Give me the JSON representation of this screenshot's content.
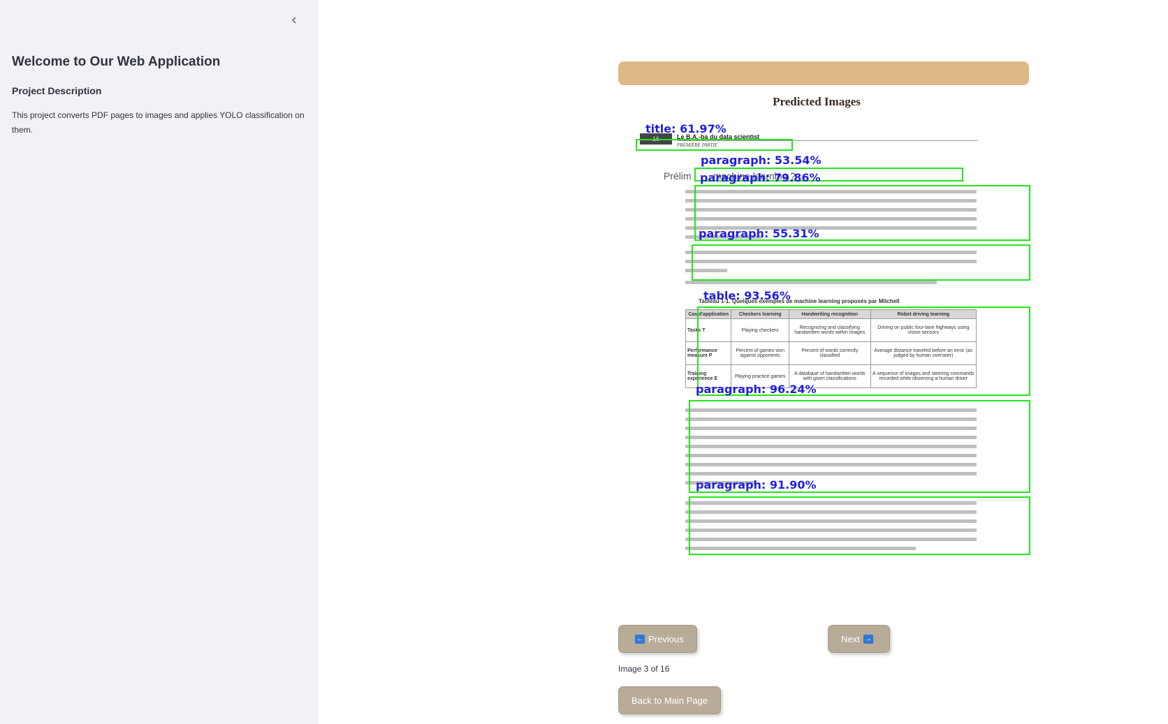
{
  "sidebar": {
    "title": "Welcome to Our Web Application",
    "section_heading": "Project Description",
    "description": "This project converts PDF pages to images and applies YOLO classification on them."
  },
  "main": {
    "heading": "Predicted Images",
    "banner_color": "#deb887",
    "predicted_image": {
      "page_number": "16",
      "page_header": "Le B.A.-ba du data scientist",
      "page_subheader": "PREMIÈRE PARTIE",
      "section_title": "Prélim        machine learning ?",
      "table_caption": "Tableau 1-1. Quelques exemples de machine learning proposés par Mitchell",
      "table": {
        "headers": [
          "Cas d'application",
          "Checkers learning",
          "Handwriting recognition",
          "Robot driving learning"
        ],
        "rows": [
          [
            "Tasks T",
            "Playing checkers",
            "Recognizing and classifying handwritten words within images",
            "Driving on public four-lane highways using vision sensors"
          ],
          [
            "Performance measure P",
            "Percent of games won against opponents",
            "Percent of words correctly classified",
            "Average distance traveled before an error (as judged by human overseer)"
          ],
          [
            "Training experience E",
            "Playing practice games",
            "A database of handwritten words with given classifications",
            "A sequence of images and steering commands recorded while observing a human driver"
          ]
        ]
      },
      "detections": [
        {
          "label": "title: 61.97%",
          "class": "title",
          "confidence": 61.97
        },
        {
          "label": "paragraph: 53.54%",
          "class": "paragraph",
          "confidence": 53.54
        },
        {
          "label": "paragraph: 79.86%",
          "class": "paragraph",
          "confidence": 79.86
        },
        {
          "label": "paragraph: 55.31%",
          "class": "paragraph",
          "confidence": 55.31
        },
        {
          "label": "table: 93.56%",
          "class": "table",
          "confidence": 93.56
        },
        {
          "label": "paragraph: 96.24%",
          "class": "paragraph",
          "confidence": 96.24
        },
        {
          "label": "paragraph: 91.90%",
          "class": "paragraph",
          "confidence": 91.9
        }
      ],
      "box_color": "#22e51b",
      "label_color": "#1f1fe0"
    },
    "previous_label": "Previous",
    "next_label": "Next",
    "counter": "Image 3 of 16",
    "back_label": "Back to Main Page"
  },
  "icons": {
    "collapse": "chevron-left-icon",
    "previous": "arrow-left-icon",
    "next": "arrow-right-icon"
  }
}
